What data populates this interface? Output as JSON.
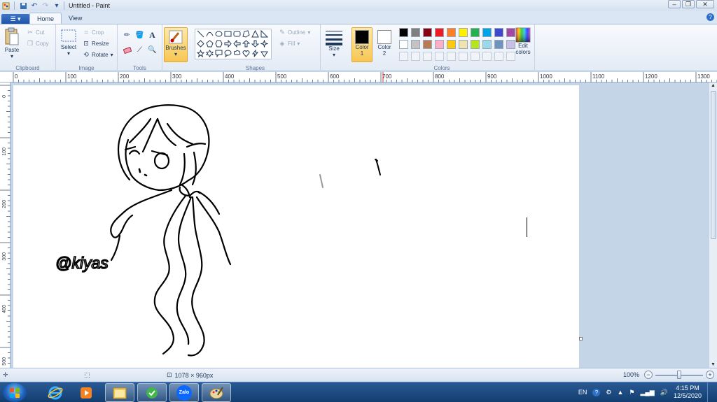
{
  "window": {
    "title": "Untitled - Paint"
  },
  "tabs": [
    {
      "label": "Home"
    },
    {
      "label": "View"
    }
  ],
  "clipboard": {
    "paste": "Paste",
    "cut": "Cut",
    "copy": "Copy",
    "label": "Clipboard"
  },
  "image": {
    "select": "Select",
    "crop": "Crop",
    "resize": "Resize",
    "rotate": "Rotate",
    "label": "Image"
  },
  "tools": {
    "label": "Tools"
  },
  "brushes": {
    "label": "Brushes"
  },
  "shapes": {
    "outline": "Outline",
    "fill": "Fill",
    "label": "Shapes"
  },
  "size": {
    "label": "Size"
  },
  "colors": {
    "color1_label": "Color",
    "color1_num": "1",
    "color1_value": "#000000",
    "color2_label": "Color",
    "color2_num": "2",
    "color2_value": "#ffffff",
    "edit_label": "Edit",
    "edit_label2": "colors",
    "group_label": "Colors",
    "palette": [
      "#000000",
      "#7f7f7f",
      "#880015",
      "#ed1c24",
      "#ff7f27",
      "#fff200",
      "#22b14c",
      "#00a2e8",
      "#3f48cc",
      "#a349a4",
      "#ffffff",
      "#c3c3c3",
      "#b97a57",
      "#ffaec9",
      "#ffc90e",
      "#efe4b0",
      "#b5e61d",
      "#99d9ea",
      "#7092be",
      "#c8bfe7"
    ]
  },
  "ruler": {
    "h_labels": [
      "0",
      "100",
      "200",
      "300",
      "400",
      "500",
      "600",
      "700",
      "800",
      "900",
      "1000",
      "1100",
      "1200",
      "1300"
    ],
    "v_labels": [
      "0",
      "100",
      "200",
      "300",
      "400",
      "500"
    ]
  },
  "canvas": {
    "signature": "@kiyas"
  },
  "status": {
    "dimensions": "1078 × 960px",
    "zoom": "100%",
    "zoom_fraction": 0.5
  },
  "taskbar": {
    "language": "EN",
    "time": "4:15 PM",
    "date": "12/5/2020",
    "apps": [
      "internet-explorer",
      "media-player",
      "file-explorer",
      "green-app",
      "zalo",
      "paint"
    ],
    "zalo_label": "Zalo"
  }
}
